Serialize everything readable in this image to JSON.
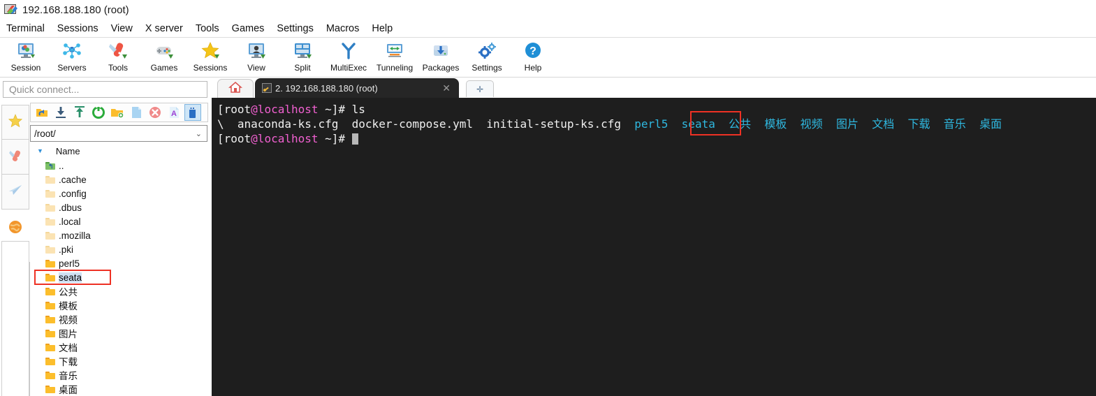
{
  "window": {
    "title": "192.168.188.180 (root)",
    "icon": "mobaxterm-logo-icon"
  },
  "menubar": {
    "items": [
      {
        "label": "Terminal",
        "name": "menu-terminal"
      },
      {
        "label": "Sessions",
        "name": "menu-sessions"
      },
      {
        "label": "View",
        "name": "menu-view"
      },
      {
        "label": "X server",
        "name": "menu-xserver"
      },
      {
        "label": "Tools",
        "name": "menu-tools"
      },
      {
        "label": "Games",
        "name": "menu-games"
      },
      {
        "label": "Settings",
        "name": "menu-settings"
      },
      {
        "label": "Macros",
        "name": "menu-macros"
      },
      {
        "label": "Help",
        "name": "menu-help"
      }
    ]
  },
  "toolbar": {
    "buttons": [
      {
        "label": "Session",
        "icon": "session-monitor-icon"
      },
      {
        "label": "Servers",
        "icon": "servers-network-icon"
      },
      {
        "label": "Tools",
        "icon": "tools-knife-icon"
      },
      {
        "label": "Games",
        "icon": "games-gamepad-icon"
      },
      {
        "label": "Sessions",
        "icon": "sessions-star-icon"
      },
      {
        "label": "View",
        "icon": "view-monitor-icon"
      },
      {
        "label": "Split",
        "icon": "split-panes-icon"
      },
      {
        "label": "MultiExec",
        "icon": "multiexec-fork-icon"
      },
      {
        "label": "Tunneling",
        "icon": "tunneling-arrows-icon"
      },
      {
        "label": "Packages",
        "icon": "packages-download-icon"
      },
      {
        "label": "Settings",
        "icon": "settings-gears-icon"
      },
      {
        "label": "Help",
        "icon": "help-question-icon"
      }
    ]
  },
  "quick_connect": {
    "placeholder": "Quick connect...",
    "value": ""
  },
  "left_strip": {
    "buttons": [
      {
        "icon": "favorites-star-icon"
      },
      {
        "icon": "tools-knife-icon"
      },
      {
        "icon": "send-paperplane-icon"
      },
      {
        "icon": "globe-icon"
      }
    ]
  },
  "file_browser": {
    "toolbar_icons": [
      {
        "icon": "parent-folder-icon",
        "selected": false
      },
      {
        "icon": "download-icon",
        "selected": false
      },
      {
        "icon": "upload-icon",
        "selected": false
      },
      {
        "icon": "refresh-icon",
        "selected": false
      },
      {
        "icon": "new-folder-icon",
        "selected": false
      },
      {
        "icon": "new-file-icon",
        "selected": false
      },
      {
        "icon": "delete-icon",
        "selected": false
      },
      {
        "icon": "text-format-icon",
        "selected": false
      },
      {
        "icon": "drive-usb-icon",
        "selected": true
      }
    ],
    "path": "/root/",
    "column_header": "Name",
    "sort_indicator": "▼",
    "rows": [
      {
        "name": "..",
        "kind": "parent",
        "selected": false
      },
      {
        "name": ".cache",
        "kind": "hidden",
        "selected": false
      },
      {
        "name": ".config",
        "kind": "hidden",
        "selected": false
      },
      {
        "name": ".dbus",
        "kind": "hidden",
        "selected": false
      },
      {
        "name": ".local",
        "kind": "hidden",
        "selected": false
      },
      {
        "name": ".mozilla",
        "kind": "hidden",
        "selected": false
      },
      {
        "name": ".pki",
        "kind": "hidden",
        "selected": false
      },
      {
        "name": "perl5",
        "kind": "folder",
        "selected": false
      },
      {
        "name": "seata",
        "kind": "folder",
        "selected": true
      },
      {
        "name": "公共",
        "kind": "folder",
        "selected": false
      },
      {
        "name": "模板",
        "kind": "folder",
        "selected": false
      },
      {
        "name": "视频",
        "kind": "folder",
        "selected": false
      },
      {
        "name": "图片",
        "kind": "folder",
        "selected": false
      },
      {
        "name": "文档",
        "kind": "folder",
        "selected": false
      },
      {
        "name": "下载",
        "kind": "folder",
        "selected": false
      },
      {
        "name": "音乐",
        "kind": "folder",
        "selected": false
      },
      {
        "name": "桌面",
        "kind": "folder",
        "selected": false
      }
    ],
    "highlight": "seata"
  },
  "tabs": {
    "home_icon": "home-icon",
    "session_tab": {
      "label": "2. 192.168.188.180 (root)",
      "icon": "ssh-key-icon",
      "close_label": "✕",
      "active": true
    },
    "new_tab_label": "✛"
  },
  "terminal": {
    "lines": [
      {
        "segments": [
          {
            "text": "[",
            "color": "white"
          },
          {
            "text": "root",
            "color": "white"
          },
          {
            "text": "@localhost",
            "color": "magenta"
          },
          {
            "text": " ~]# ls",
            "color": "white"
          }
        ]
      },
      {
        "segments": [
          {
            "text": "\\  anaconda-ks.cfg  docker-compose.yml  initial-setup-ks.cfg  ",
            "color": "white"
          },
          {
            "text": "perl5",
            "color": "dir"
          },
          {
            "text": "  ",
            "color": "white"
          },
          {
            "text": "seata",
            "color": "dir"
          },
          {
            "text": "  ",
            "color": "white"
          },
          {
            "text": "公共",
            "color": "dir"
          },
          {
            "text": "  ",
            "color": "white"
          },
          {
            "text": "模板",
            "color": "dir"
          },
          {
            "text": "  ",
            "color": "white"
          },
          {
            "text": "视频",
            "color": "dir"
          },
          {
            "text": "  ",
            "color": "white"
          },
          {
            "text": "图片",
            "color": "dir"
          },
          {
            "text": "  ",
            "color": "white"
          },
          {
            "text": "文档",
            "color": "dir"
          },
          {
            "text": "  ",
            "color": "white"
          },
          {
            "text": "下载",
            "color": "dir"
          },
          {
            "text": "  ",
            "color": "white"
          },
          {
            "text": "音乐",
            "color": "dir"
          },
          {
            "text": "  ",
            "color": "white"
          },
          {
            "text": "桌面",
            "color": "dir"
          }
        ]
      },
      {
        "segments": [
          {
            "text": "[",
            "color": "white"
          },
          {
            "text": "root",
            "color": "white"
          },
          {
            "text": "@localhost",
            "color": "magenta"
          },
          {
            "text": " ~]# ",
            "color": "white"
          },
          {
            "text": "",
            "color": "cursor"
          }
        ]
      }
    ],
    "highlighted_word": "seata"
  },
  "colors": {
    "terminal_bg": "#1e1e1e",
    "terminal_fg": "#f0f0f0",
    "terminal_dir": "#2fb8e0",
    "terminal_host": "#f060d0",
    "highlight_box": "#ee3124",
    "selection": "#cfe0f2",
    "accent": "#2f8fd8"
  }
}
